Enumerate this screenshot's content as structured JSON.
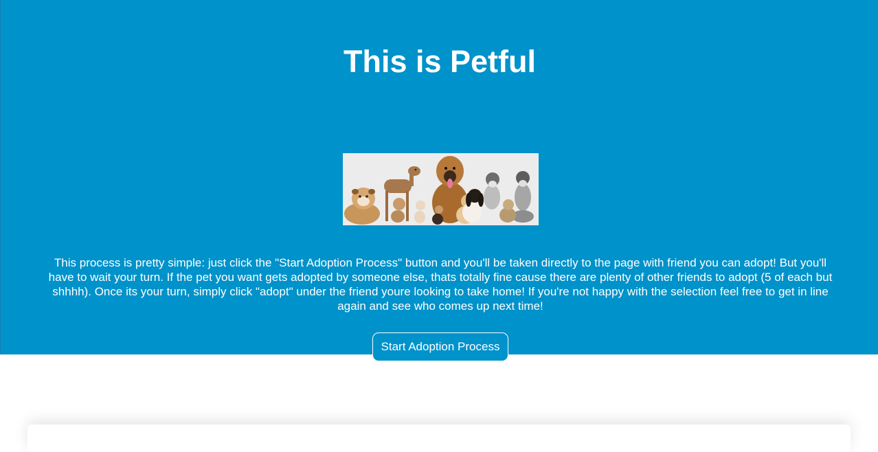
{
  "hero": {
    "title": "This is Petful",
    "image_alt": "Group of dogs",
    "description": "This process is pretty simple: just click the \"Start Adoption Process\" button and you'll be taken directly to the page with friend you can adopt! But you'll have to wait your turn. If the pet you want gets adopted by someone else, thats totally fine cause there are plenty of other friends to adopt (5 of each but shhhh). Once its your turn, simply click \"adopt\" under the friend youre looking to take home! If you're not happy with the selection feel free to get in line again and see who comes up next time!",
    "start_button_label": "Start Adoption Process"
  },
  "colors": {
    "hero_background": "#0092ca",
    "text": "#ffffff",
    "page_background": "#ffffff"
  }
}
